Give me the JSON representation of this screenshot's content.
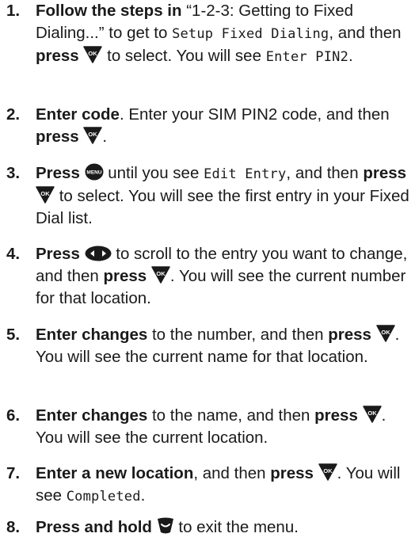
{
  "steps": [
    {
      "number": "1.",
      "parts": [
        {
          "t": "b",
          "v": "Follow the steps in"
        },
        {
          "t": "s",
          "v": " “1-2-3: Getting to Fixed Dialing...” to get to "
        },
        {
          "t": "lcd",
          "v": "Setup Fixed Dialing"
        },
        {
          "t": "s",
          "v": ", and then "
        },
        {
          "t": "b",
          "v": "press"
        },
        {
          "t": "s",
          "v": " "
        },
        {
          "t": "icon",
          "v": "ok-key-icon"
        },
        {
          "t": "s",
          "v": " to select. You will see "
        },
        {
          "t": "lcd",
          "v": "Enter PIN2"
        },
        {
          "t": "s",
          "v": "."
        }
      ]
    },
    {
      "number": "2.",
      "parts": [
        {
          "t": "b",
          "v": "Enter code"
        },
        {
          "t": "s",
          "v": ". Enter your SIM PIN2 code, and then "
        },
        {
          "t": "b",
          "v": "press"
        },
        {
          "t": "s",
          "v": " "
        },
        {
          "t": "icon",
          "v": "ok-key-icon"
        },
        {
          "t": "s",
          "v": "."
        }
      ]
    },
    {
      "number": "3.",
      "parts": [
        {
          "t": "b",
          "v": "Press"
        },
        {
          "t": "s",
          "v": " "
        },
        {
          "t": "icon",
          "v": "menu-key-icon"
        },
        {
          "t": "s",
          "v": " until you see "
        },
        {
          "t": "lcd",
          "v": "Edit Entry"
        },
        {
          "t": "s",
          "v": ", and then "
        },
        {
          "t": "b",
          "v": "press"
        },
        {
          "t": "s",
          "v": " "
        },
        {
          "t": "icon",
          "v": "ok-key-icon"
        },
        {
          "t": "s",
          "v": " to select. You will see the first entry in your Fixed Dial list."
        }
      ]
    },
    {
      "number": "4.",
      "parts": [
        {
          "t": "b",
          "v": "Press"
        },
        {
          "t": "s",
          "v": " "
        },
        {
          "t": "icon",
          "v": "scroll-key-icon"
        },
        {
          "t": "s",
          "v": " to scroll to the entry you want to change, and then "
        },
        {
          "t": "b",
          "v": "press"
        },
        {
          "t": "s",
          "v": " "
        },
        {
          "t": "icon",
          "v": "ok-key-icon"
        },
        {
          "t": "s",
          "v": ". You will see the current number for that location."
        }
      ]
    },
    {
      "number": "5.",
      "parts": [
        {
          "t": "b",
          "v": "Enter changes"
        },
        {
          "t": "s",
          "v": " to the number, and then "
        },
        {
          "t": "b",
          "v": "press"
        },
        {
          "t": "s",
          "v": " "
        },
        {
          "t": "icon",
          "v": "ok-key-icon"
        },
        {
          "t": "s",
          "v": ". You will see the current name for that location."
        }
      ]
    },
    {
      "number": "6.",
      "parts": [
        {
          "t": "b",
          "v": "Enter changes"
        },
        {
          "t": "s",
          "v": " to the name, and then "
        },
        {
          "t": "b",
          "v": "press"
        },
        {
          "t": "s",
          "v": " "
        },
        {
          "t": "icon",
          "v": "ok-key-icon"
        },
        {
          "t": "s",
          "v": ". You will see the current location."
        }
      ]
    },
    {
      "number": "7.",
      "parts": [
        {
          "t": "b",
          "v": "Enter a new location"
        },
        {
          "t": "s",
          "v": ", and then "
        },
        {
          "t": "b",
          "v": "press"
        },
        {
          "t": "s",
          "v": " "
        },
        {
          "t": "icon",
          "v": "ok-key-icon"
        },
        {
          "t": "s",
          "v": ". You will see "
        },
        {
          "t": "lcd",
          "v": "Completed"
        },
        {
          "t": "s",
          "v": "."
        }
      ]
    },
    {
      "number": "8.",
      "parts": [
        {
          "t": "b",
          "v": "Press and hold"
        },
        {
          "t": "s",
          "v": " "
        },
        {
          "t": "icon",
          "v": "end-key-icon"
        },
        {
          "t": "s",
          "v": " to exit the menu."
        }
      ]
    }
  ]
}
